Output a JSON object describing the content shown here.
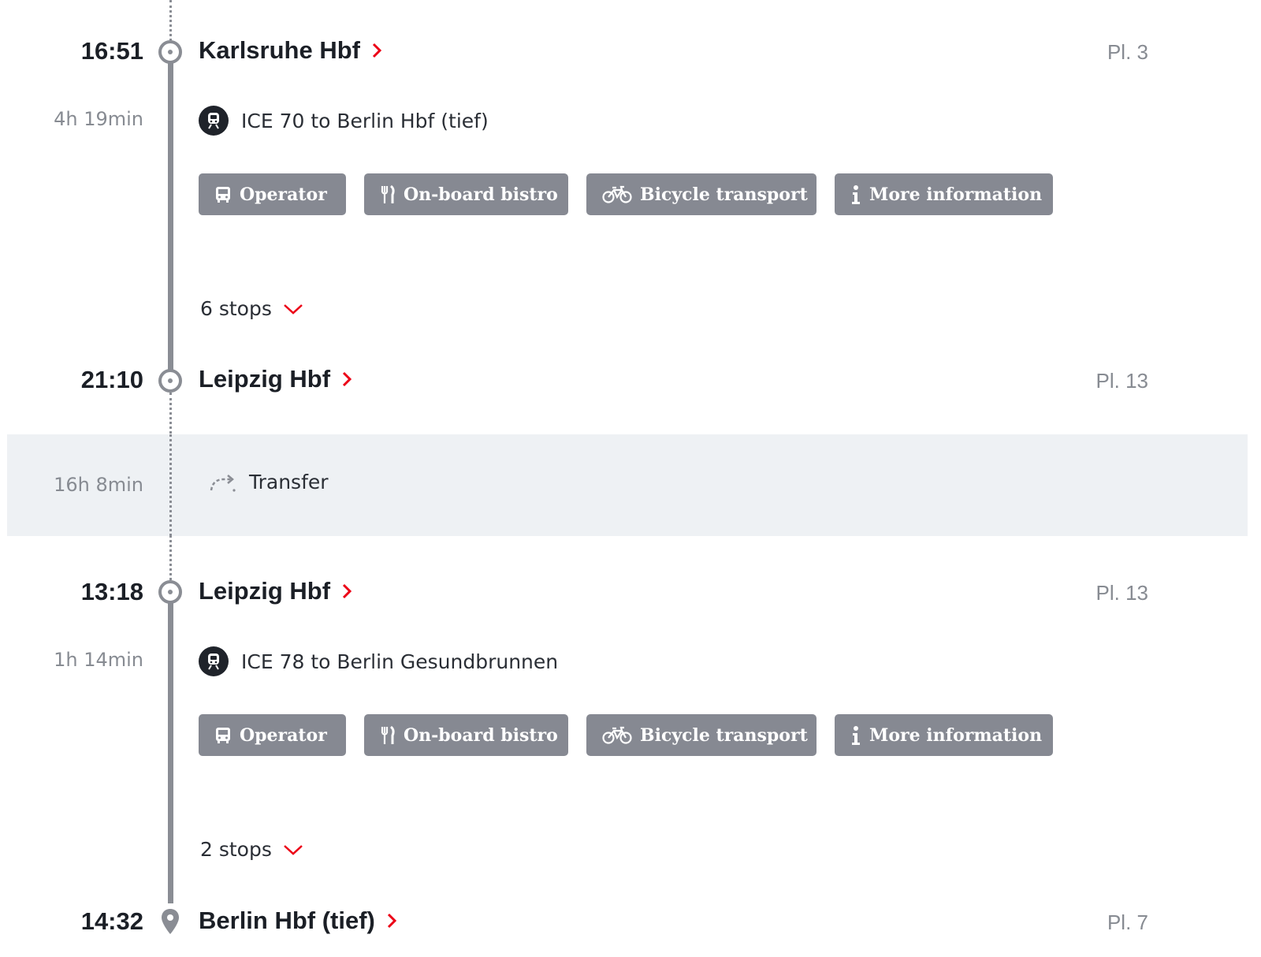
{
  "legs": [
    {
      "departure": {
        "time": "16:51",
        "station": "Karlsruhe Hbf",
        "platform": "Pl. 3"
      },
      "duration": "4h 19min",
      "train": {
        "label": "ICE 70 to Berlin Hbf (tief)",
        "icon": "train-icon"
      },
      "chips": [
        {
          "label": "Operator",
          "icon": "bus-icon"
        },
        {
          "label": "On-board bistro",
          "icon": "fork-knife-icon"
        },
        {
          "label": "Bicycle transport",
          "icon": "bicycle-icon"
        },
        {
          "label": "More information",
          "icon": "info-icon"
        }
      ],
      "stops": "6 stops",
      "arrival": {
        "time": "21:10",
        "station": "Leipzig Hbf",
        "platform": "Pl. 13"
      }
    },
    {
      "departure": {
        "time": "13:18",
        "station": "Leipzig Hbf",
        "platform": "Pl. 13"
      },
      "duration": "1h 14min",
      "train": {
        "label": "ICE 78 to Berlin Gesundbrunnen",
        "icon": "train-icon"
      },
      "chips": [
        {
          "label": "Operator",
          "icon": "bus-icon"
        },
        {
          "label": "On-board bistro",
          "icon": "fork-knife-icon"
        },
        {
          "label": "Bicycle transport",
          "icon": "bicycle-icon"
        },
        {
          "label": "More information",
          "icon": "info-icon"
        }
      ],
      "stops": "2 stops",
      "arrival": {
        "time": "14:32",
        "station": "Berlin Hbf (tief)",
        "platform": "Pl. 7"
      }
    }
  ],
  "transfer": {
    "duration": "16h 8min",
    "label": "Transfer",
    "icon": "transfer-icon"
  },
  "colors": {
    "accent_red": "#ec0016",
    "chip_bg": "#868992",
    "timeline": "#8a8d94",
    "transfer_bg": "#eef1f4",
    "text": "#1b1f26",
    "muted": "#878b92"
  }
}
